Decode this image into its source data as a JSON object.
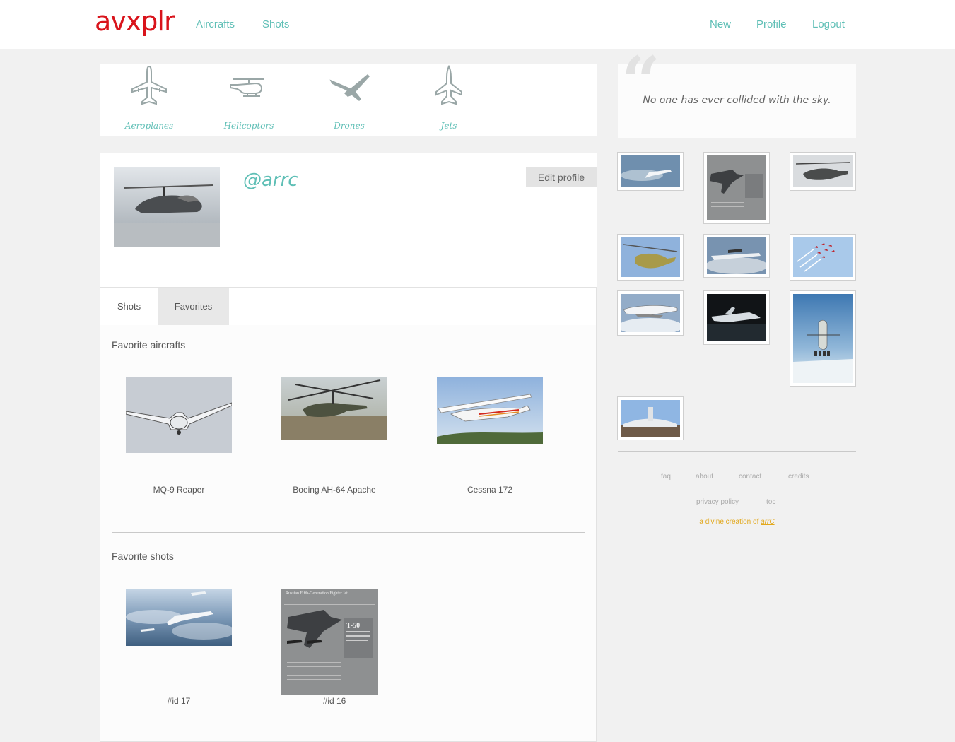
{
  "header": {
    "logo": "avxplr",
    "nav_left": [
      "Aircrafts",
      "Shots"
    ],
    "nav_right": [
      "New",
      "Profile",
      "Logout"
    ]
  },
  "categories": [
    "Aeroplanes",
    "Helicoptors",
    "Drones",
    "Jets"
  ],
  "quote": "No one has ever collided with the sky.",
  "profile": {
    "username": "@arrc",
    "edit_label": "Edit profile",
    "tabs": [
      "Shots",
      "Favorites"
    ],
    "active_tab": "Favorites"
  },
  "favorites": {
    "aircrafts_title": "Favorite aircrafts",
    "aircrafts": [
      "MQ-9 Reaper",
      "Boeing AH-64 Apache",
      "Cessna 172"
    ],
    "shots_title": "Favorite shots",
    "shots": [
      "#id 17",
      "#id 16"
    ],
    "poster": {
      "title": "Russian Fifth-Generation Fighter Jet",
      "subtitle": "T-50"
    }
  },
  "footer": {
    "links": [
      "faq",
      "about",
      "contact",
      "credits"
    ],
    "links2": [
      "privacy policy",
      "toc"
    ],
    "credit_prefix": "a divine creation of",
    "credit_name": "arrC"
  },
  "colors": {
    "brand": "#d9141c",
    "accent": "#5fbfb6",
    "credit": "#e2a81c"
  }
}
